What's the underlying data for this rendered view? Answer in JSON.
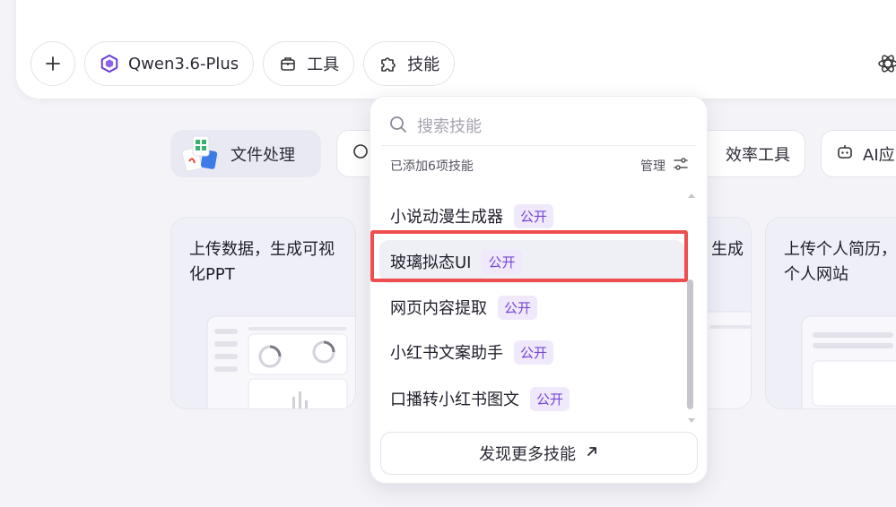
{
  "toolbar": {
    "model_label": "Qwen3.6-Plus",
    "tools_label": "工具",
    "skills_label": "技能"
  },
  "categories": [
    {
      "label": "文件处理"
    },
    {
      "label": "效率工具"
    },
    {
      "label": "AI应"
    }
  ],
  "cards": [
    {
      "text1": "上传数据，生成可视",
      "text2": "化PPT"
    },
    {
      "text1": "生成",
      "text2": ""
    },
    {
      "text1": "上传个人简历，",
      "text2": "个人网站"
    }
  ],
  "dropdown": {
    "search_placeholder": "搜索技能",
    "added_text": "已添加6项技能",
    "manage_label": "管理",
    "items": [
      {
        "name": "小说动漫生成器",
        "badge": "公开"
      },
      {
        "name": "玻璃拟态UI",
        "badge": "公开"
      },
      {
        "name": "网页内容提取",
        "badge": "公开"
      },
      {
        "name": "小红书文案助手",
        "badge": "公开"
      },
      {
        "name": "口播转小红书图文",
        "badge": "公开"
      }
    ],
    "discover_label": "发现更多技能"
  },
  "colors": {
    "accent_purple": "#7445d8",
    "badge_bg": "#efe9fb",
    "highlight_red": "#ef4e4e"
  }
}
